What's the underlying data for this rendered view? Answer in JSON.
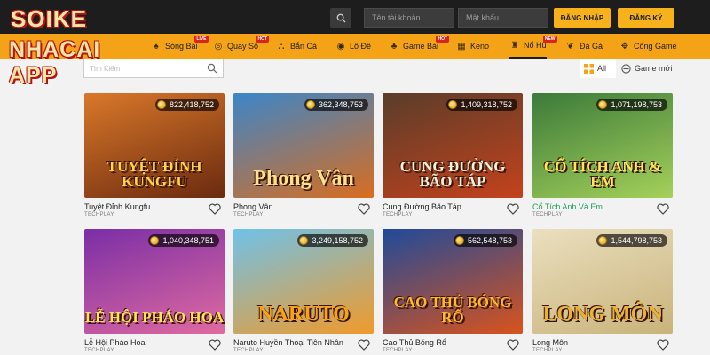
{
  "logo": {
    "line1": "SOIKE",
    "line2": "NHACAI APP"
  },
  "header": {
    "username_placeholder": "Tên tài khoản",
    "password_placeholder": "Mật khẩu",
    "login_label": "ĐĂNG NHẬP",
    "register_label": "ĐĂNG KÝ"
  },
  "nav": [
    {
      "label": "Sòng Bài",
      "icon": "cards-icon",
      "badge": "LIVE"
    },
    {
      "label": "Quay Số",
      "icon": "lottery-icon",
      "badge": "HOT"
    },
    {
      "label": "Bắn Cá",
      "icon": "fish-icon",
      "badge": ""
    },
    {
      "label": "Lô Đề",
      "icon": "lotto-icon",
      "badge": ""
    },
    {
      "label": "Game Bài",
      "icon": "card-game-icon",
      "badge": "HOT"
    },
    {
      "label": "Keno",
      "icon": "keno-icon",
      "badge": ""
    },
    {
      "label": "Nổ Hũ",
      "icon": "jackpot-icon",
      "badge": "NEW"
    },
    {
      "label": "Đá Gà",
      "icon": "rooster-icon",
      "badge": ""
    },
    {
      "label": "Cổng Game",
      "icon": "gamepad-icon",
      "badge": ""
    }
  ],
  "filter": {
    "search_placeholder": "Tìm Kiếm",
    "view_all_label": "All",
    "view_new_label": "Game mới"
  },
  "games": [
    {
      "title": "Tuyệt Đỉnh Kungfu",
      "provider": "TECHPLAY",
      "jackpot": "822,418,752",
      "art": "TUYỆT ĐỈNH KUNGFU",
      "colors": [
        "#d9782a",
        "#6b2a0f"
      ],
      "artColor": "#ffd34d"
    },
    {
      "title": "Phong Vân",
      "provider": "TECHPLAY",
      "jackpot": "362,348,753",
      "art": "Phong Vân",
      "colors": [
        "#3b86c9",
        "#d96d1f"
      ],
      "artColor": "#ffe08a"
    },
    {
      "title": "Cung Đường Bão Táp",
      "provider": "TECHPLAY",
      "jackpot": "1,409,318,752",
      "art": "CUNG ĐƯỜNG BÃO TÁP",
      "colors": [
        "#5a3d2a",
        "#c4421c"
      ],
      "artColor": "#f3f0e0"
    },
    {
      "title": "Cổ Tích Anh Và Em",
      "provider": "TECHPLAY",
      "jackpot": "1,071,198,753",
      "art": "CỔ TÍCH ANH & EM",
      "colors": [
        "#3b7a3a",
        "#a5d15a"
      ],
      "artColor": "#ffe65a"
    },
    {
      "title": "Lễ Hội Pháo Hoa",
      "provider": "TECHPLAY",
      "jackpot": "1,040,348,751",
      "art": "LỄ HỘI PHÁO HOA",
      "colors": [
        "#7a2ea6",
        "#e06aa0"
      ],
      "artColor": "#ffe45a"
    },
    {
      "title": "Naruto Huyền Thoại Tiên Nhân",
      "provider": "TECHPLAY",
      "jackpot": "3,249,158,752",
      "art": "NARUTO",
      "colors": [
        "#6fc2ea",
        "#f09a2a"
      ],
      "artColor": "#f7a21b"
    },
    {
      "title": "Cao Thủ Bóng Rổ",
      "provider": "TECHPLAY",
      "jackpot": "562,548,753",
      "art": "CAO THỦ BÓNG RỔ",
      "colors": [
        "#1f4a9a",
        "#d9531c"
      ],
      "artColor": "#ffb92a"
    },
    {
      "title": "Long Môn",
      "provider": "TECHPLAY",
      "jackpot": "1,544,798,753",
      "art": "LONG MÔN",
      "colors": [
        "#eadfbf",
        "#c9b37a"
      ],
      "artColor": "#e8b23a"
    }
  ],
  "highlighted_game_index": 3,
  "accent": {
    "nav": "#f4a316",
    "button": "#f7b21b",
    "topbar": "#1d1d1d"
  }
}
